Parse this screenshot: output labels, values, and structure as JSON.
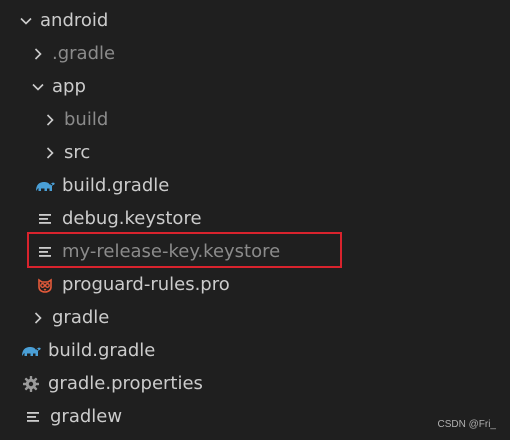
{
  "colors": {
    "background": "#1f1f1f",
    "text": "#cccccc",
    "dim_text": "#8b8b8b",
    "gradle_icon": "#4a9fd6",
    "highlight_box": "#d9232d",
    "proguard_icon": "#e45a3a"
  },
  "tree": {
    "items": [
      {
        "label": "android",
        "icon": "chevron-down-icon"
      },
      {
        "label": ".gradle",
        "icon": "chevron-right-icon"
      },
      {
        "label": "app",
        "icon": "chevron-down-icon"
      },
      {
        "label": "build",
        "icon": "chevron-right-icon"
      },
      {
        "label": "src",
        "icon": "chevron-right-icon"
      },
      {
        "label": "build.gradle",
        "icon": "gradle-elephant-icon"
      },
      {
        "label": "debug.keystore",
        "icon": "text-file-icon"
      },
      {
        "label": "my-release-key.keystore",
        "icon": "text-file-icon"
      },
      {
        "label": "proguard-rules.pro",
        "icon": "proguard-owl-icon"
      },
      {
        "label": "gradle",
        "icon": "chevron-right-icon"
      },
      {
        "label": "build.gradle",
        "icon": "gradle-elephant-icon"
      },
      {
        "label": "gradle.properties",
        "icon": "gear-icon"
      },
      {
        "label": "gradlew",
        "icon": "text-file-icon"
      }
    ]
  },
  "watermark": "CSDN @Fri_"
}
